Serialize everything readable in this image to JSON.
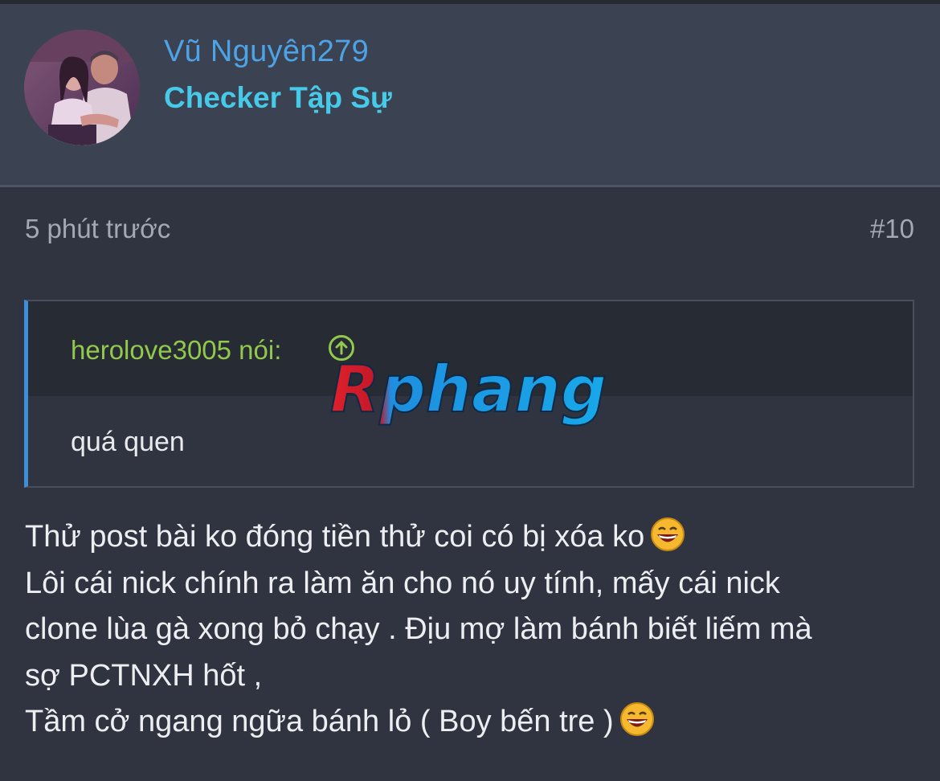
{
  "user": {
    "name": "Vũ Nguyên279",
    "title": "Checker Tập Sự",
    "avatar_icon": "user-avatar-photo"
  },
  "post": {
    "time": "5 phút trước",
    "number": "#10",
    "quote": {
      "author_label": "herolove3005 nói:",
      "jump_icon": "arrow-up-circle-icon",
      "text": "quá quen"
    },
    "lines": [
      "Thử post bài ko đóng tiền thử coi có bị xóa ko",
      "Lôi cái nick chính ra làm ăn cho nó uy tính, mấy cái nick",
      "clone lùa gà xong bỏ chạy . Địu mợ làm bánh biết liếm mà",
      "sợ PCTNXH hốt ,",
      "Tầm cở ngang ngữa bánh lỏ ( Boy bến tre )"
    ],
    "emoji_icon": "laughing-face-icon"
  },
  "watermark": {
    "text": "Rphang"
  },
  "colors": {
    "background": "#2f3440",
    "header": "#3b4251",
    "username": "#4ea3e6",
    "user_title": "#47c9e8",
    "quote_author": "#92c94c",
    "quote_border": "#3d8fd8"
  }
}
